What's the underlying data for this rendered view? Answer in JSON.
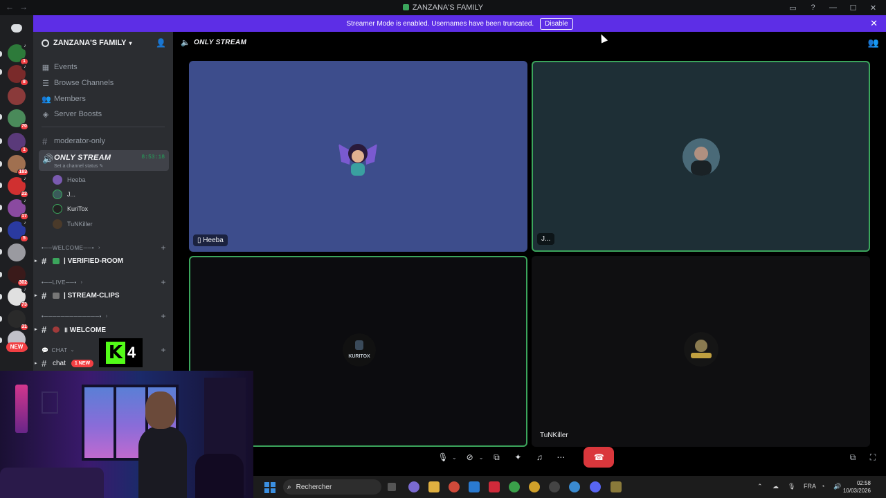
{
  "window": {
    "title": "ZANZANA'S FAMILY",
    "nav_back": "←",
    "nav_forward": "→"
  },
  "banner": {
    "message": "Streamer Mode is enabled. Usernames have been truncated.",
    "disable_label": "Disable"
  },
  "rail": {
    "badges": [
      "1",
      "8",
      "70",
      "1",
      "183",
      "22",
      "17",
      "5",
      "302",
      "73",
      "31",
      "11"
    ],
    "new_label": "NEW"
  },
  "sidebar": {
    "guild_name": "ZANZANA'S FAMILY",
    "menu": [
      {
        "label": "Events",
        "icon": "calendar-icon"
      },
      {
        "label": "Browse Channels",
        "icon": "browse-icon"
      },
      {
        "label": "Members",
        "icon": "members-icon"
      },
      {
        "label": "Server Boosts",
        "icon": "boost-icon"
      }
    ],
    "moderator_channel": "moderator-only",
    "voice_channel": {
      "name": "ONLY STREAM",
      "timer": "8:53:18",
      "status": "Set a channel status"
    },
    "voice_users": [
      "Heeba",
      "J...",
      "KuriTox",
      "TuNKiller"
    ],
    "categories": [
      {
        "label": "•──WELCOME──•",
        "channel": "| VERIFIED-ROOM"
      },
      {
        "label": "•──LIVE──•",
        "channel": "| STREAM-CLIPS"
      },
      {
        "label": "•─────────────•",
        "channel": "॥ WELCOME"
      },
      {
        "label": "CHAT",
        "channel": "chat"
      }
    ],
    "chat_new_label": "1 NEW",
    "kick_digit": "4"
  },
  "main": {
    "channel_name": "ONLY STREAM",
    "tiles": [
      {
        "label": "Heeba",
        "accent": "#3d4d8c"
      },
      {
        "label": "J...",
        "accent": "#1e2f36"
      },
      {
        "label": "",
        "accent": "#0c0c0f"
      },
      {
        "label": "TuNKiller",
        "accent": "#0f0f11"
      }
    ],
    "kuritox_logo_text": "KURITOX"
  },
  "taskbar": {
    "search_placeholder": "Rechercher",
    "language": "FRA",
    "time": "02:58",
    "date": "10/03/2026"
  },
  "colors": {
    "banner": "#5d2ee6",
    "speaking_border": "#3ba55c",
    "leave_button": "#da373c",
    "sidebar": "#2b2d31"
  }
}
